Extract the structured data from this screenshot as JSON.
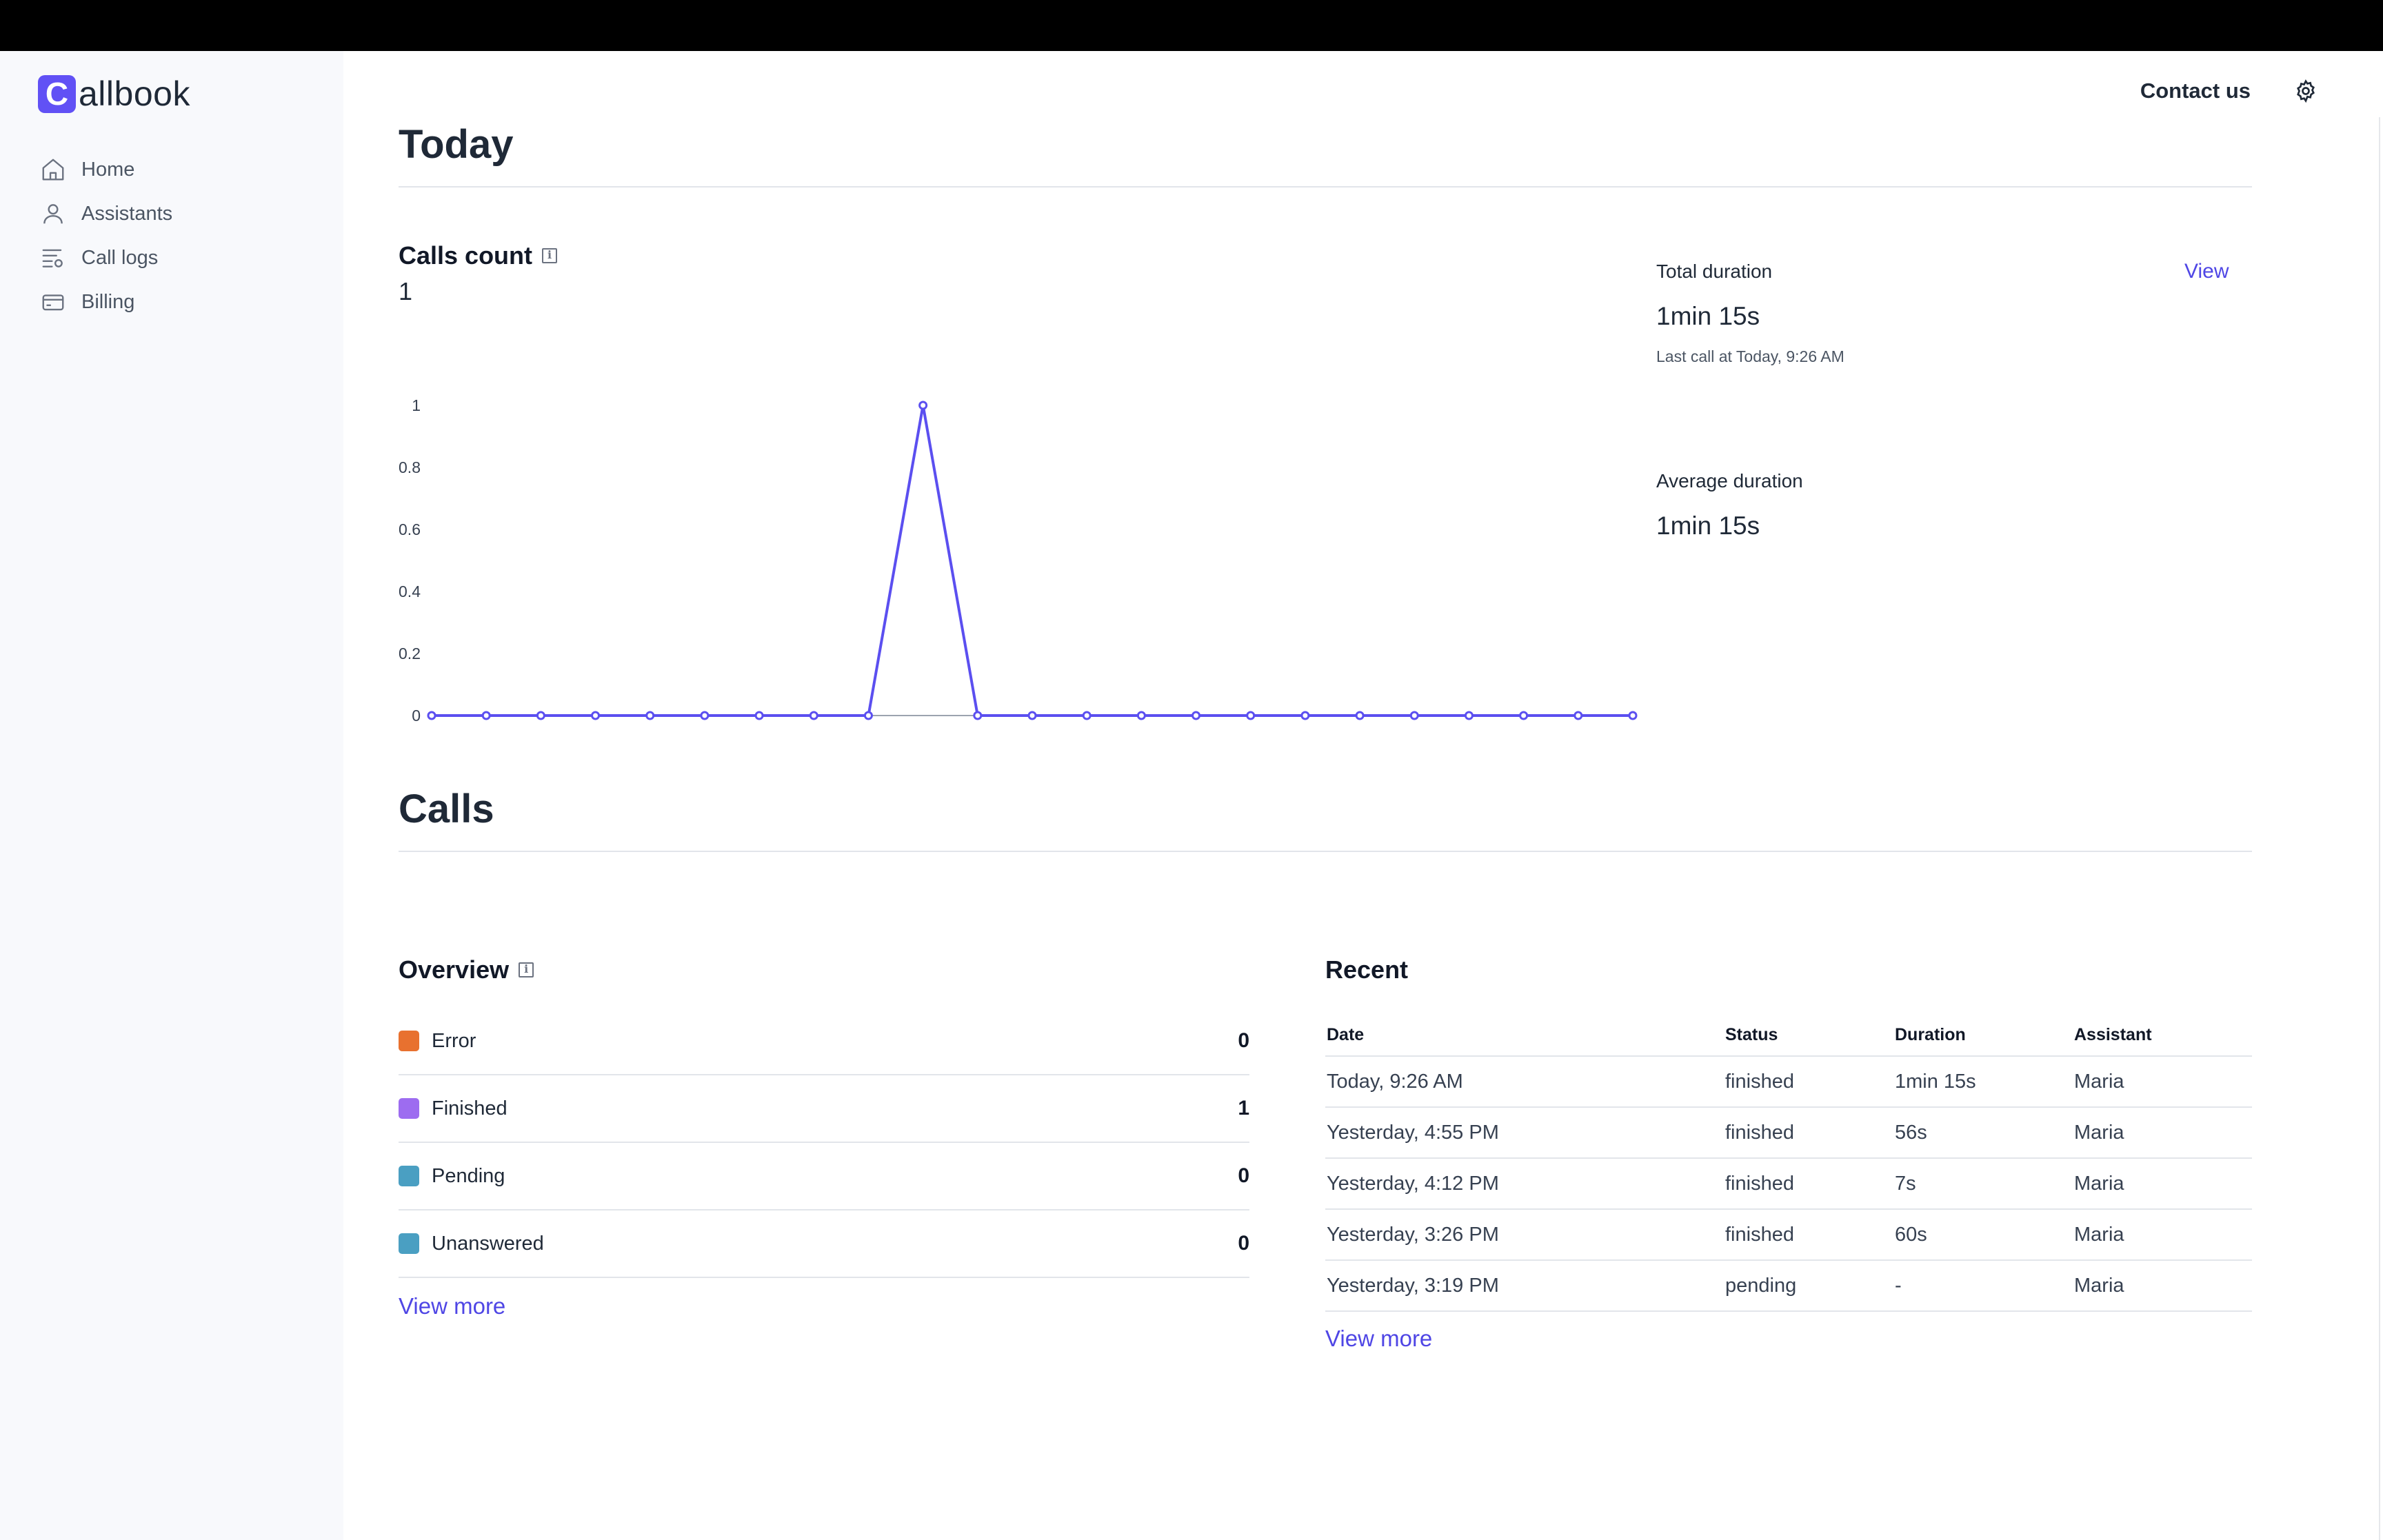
{
  "brand": {
    "mark": "C",
    "rest": "allbook"
  },
  "sidebar": {
    "items": [
      {
        "label": "Home",
        "icon": "home-icon"
      },
      {
        "label": "Assistants",
        "icon": "user-icon"
      },
      {
        "label": "Call logs",
        "icon": "call-logs-icon"
      },
      {
        "label": "Billing",
        "icon": "credit-card-icon"
      }
    ]
  },
  "header": {
    "contact": "Contact us",
    "settings_icon": "gear-icon"
  },
  "today": {
    "title": "Today",
    "calls_count": {
      "title": "Calls count",
      "value": "1"
    },
    "total_duration": {
      "label": "Total duration",
      "value": "1min 15s",
      "sub": "Last call at Today, 9:26 AM",
      "link": "View"
    },
    "average_duration": {
      "label": "Average duration",
      "value": "1min 15s"
    }
  },
  "calls": {
    "title": "Calls",
    "overview": {
      "title": "Overview",
      "rows": [
        {
          "label": "Error",
          "count": "0",
          "color": "#e8712f"
        },
        {
          "label": "Finished",
          "count": "1",
          "color": "#9d6cf0"
        },
        {
          "label": "Pending",
          "count": "0",
          "color": "#4a9fc2"
        },
        {
          "label": "Unanswered",
          "count": "0",
          "color": "#4a9fc2"
        }
      ],
      "more": "View more"
    },
    "recent": {
      "title": "Recent",
      "columns": [
        "Date",
        "Status",
        "Duration",
        "Assistant"
      ],
      "rows": [
        [
          "Today, 9:26 AM",
          "finished",
          "1min 15s",
          "Maria"
        ],
        [
          "Yesterday, 4:55 PM",
          "finished",
          "56s",
          "Maria"
        ],
        [
          "Yesterday, 4:12 PM",
          "finished",
          "7s",
          "Maria"
        ],
        [
          "Yesterday, 3:26 PM",
          "finished",
          "60s",
          "Maria"
        ],
        [
          "Yesterday, 3:19 PM",
          "pending",
          "-",
          "Maria"
        ]
      ],
      "more": "View more"
    }
  },
  "colors": {
    "accent": "#4f46e5",
    "line": "#5b4ff0",
    "brand": "#6151f5"
  },
  "chart_data": {
    "type": "line",
    "title": "Calls count",
    "x": [
      0,
      1,
      2,
      3,
      4,
      5,
      6,
      7,
      8,
      9,
      10,
      11,
      12,
      13,
      14,
      15,
      16,
      17,
      18,
      19,
      20,
      21,
      22
    ],
    "values": [
      0,
      0,
      0,
      0,
      0,
      0,
      0,
      0,
      0,
      1,
      0,
      0,
      0,
      0,
      0,
      0,
      0,
      0,
      0,
      0,
      0,
      0,
      0
    ],
    "y_ticks": [
      "0",
      "0.2",
      "0.4",
      "0.6",
      "0.8",
      "1"
    ],
    "ylim": [
      0,
      1
    ],
    "grid": false,
    "legend": "none"
  }
}
